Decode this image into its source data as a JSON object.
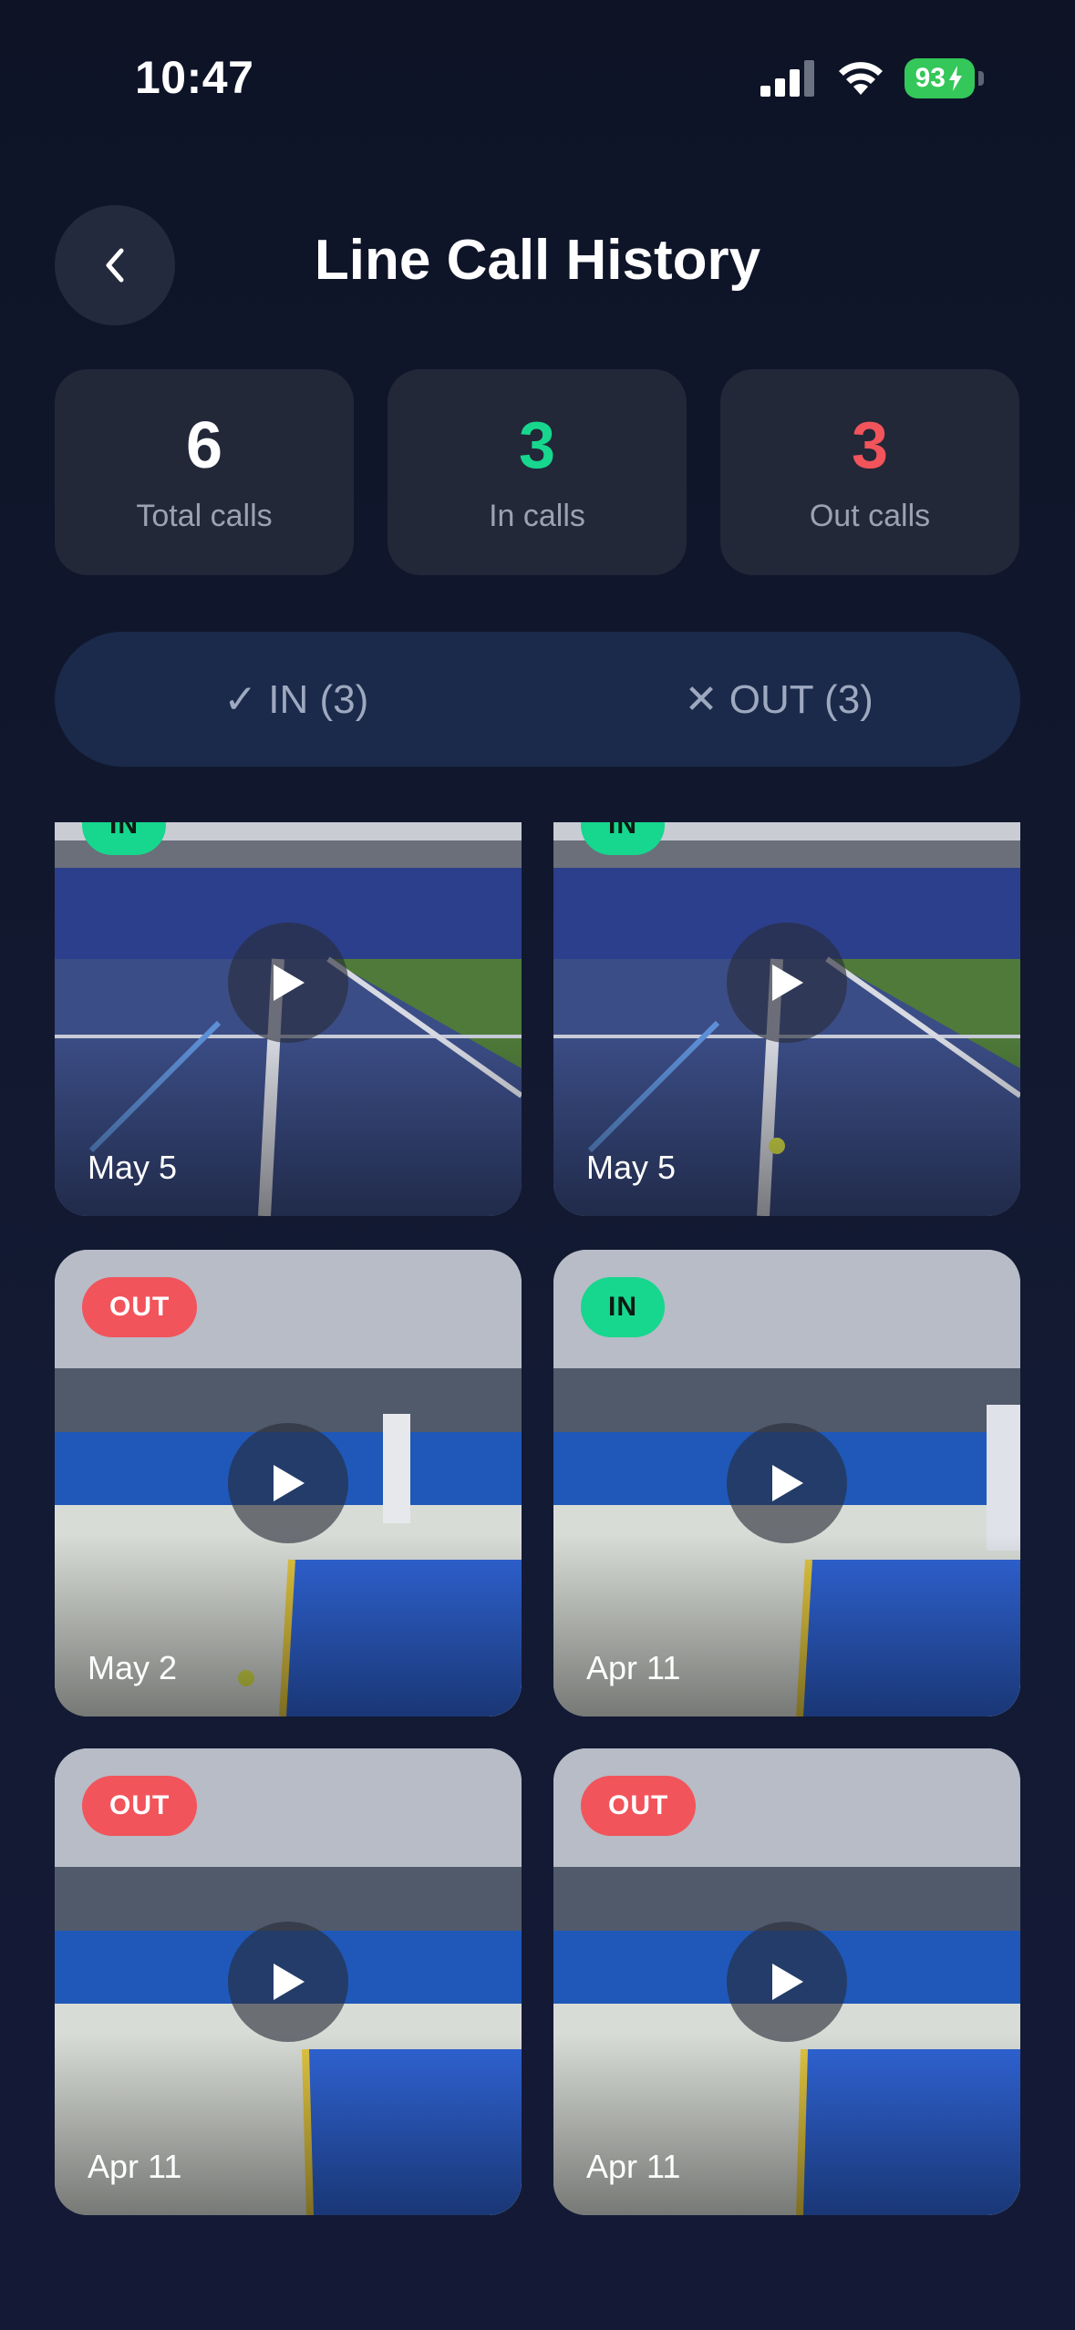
{
  "status_bar": {
    "time": "10:47",
    "battery": "93"
  },
  "header": {
    "title": "Line Call History"
  },
  "stats": [
    {
      "value": "6",
      "label": "Total calls",
      "color": "#ffffff"
    },
    {
      "value": "3",
      "label": "In calls",
      "color": "#17d68e"
    },
    {
      "value": "3",
      "label": "Out calls",
      "color": "#f2545b"
    }
  ],
  "filters": [
    {
      "label": "✓ IN (3)"
    },
    {
      "label": "✕ OUT (3)"
    }
  ],
  "clips": [
    {
      "date": "May 5",
      "call": "IN"
    },
    {
      "date": "May 5",
      "call": "IN"
    },
    {
      "date": "May 2",
      "call": "OUT"
    },
    {
      "date": "Apr 11",
      "call": "IN"
    },
    {
      "date": "Apr 11",
      "call": "OUT"
    },
    {
      "date": "Apr 11",
      "call": "OUT"
    }
  ],
  "colors": {
    "in": "#17d68e",
    "out": "#f2545b",
    "card_bg": "#222838",
    "filter_bg": "#1b2a4a"
  }
}
